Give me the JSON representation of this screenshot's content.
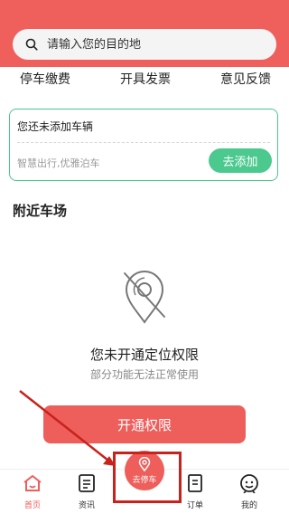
{
  "search": {
    "placeholder": "请输入您的目的地"
  },
  "quick_links": [
    "停车缴费",
    "开具发票",
    "意见反馈"
  ],
  "vehicle": {
    "title": "您还未添加车辆",
    "subtitle": "智慧出行,优雅泊车",
    "add_label": "去添加"
  },
  "nearby": {
    "title": "附近车场"
  },
  "permission": {
    "title": "您未开通定位权限",
    "subtitle": "部分功能无法正常使用",
    "button_label": "开通权限"
  },
  "tabs": [
    {
      "label": "首页",
      "icon": "home-icon",
      "active": true
    },
    {
      "label": "资讯",
      "icon": "news-icon",
      "active": false
    },
    {
      "label": "去停车",
      "icon": "location-pin-icon",
      "active": false
    },
    {
      "label": "订单",
      "icon": "order-icon",
      "active": false
    },
    {
      "label": "我的",
      "icon": "profile-icon",
      "active": false
    }
  ],
  "colors": {
    "brand_red": "#ee5e5b",
    "accent_green": "#4cc98f",
    "annotation_red": "#c8221d"
  }
}
